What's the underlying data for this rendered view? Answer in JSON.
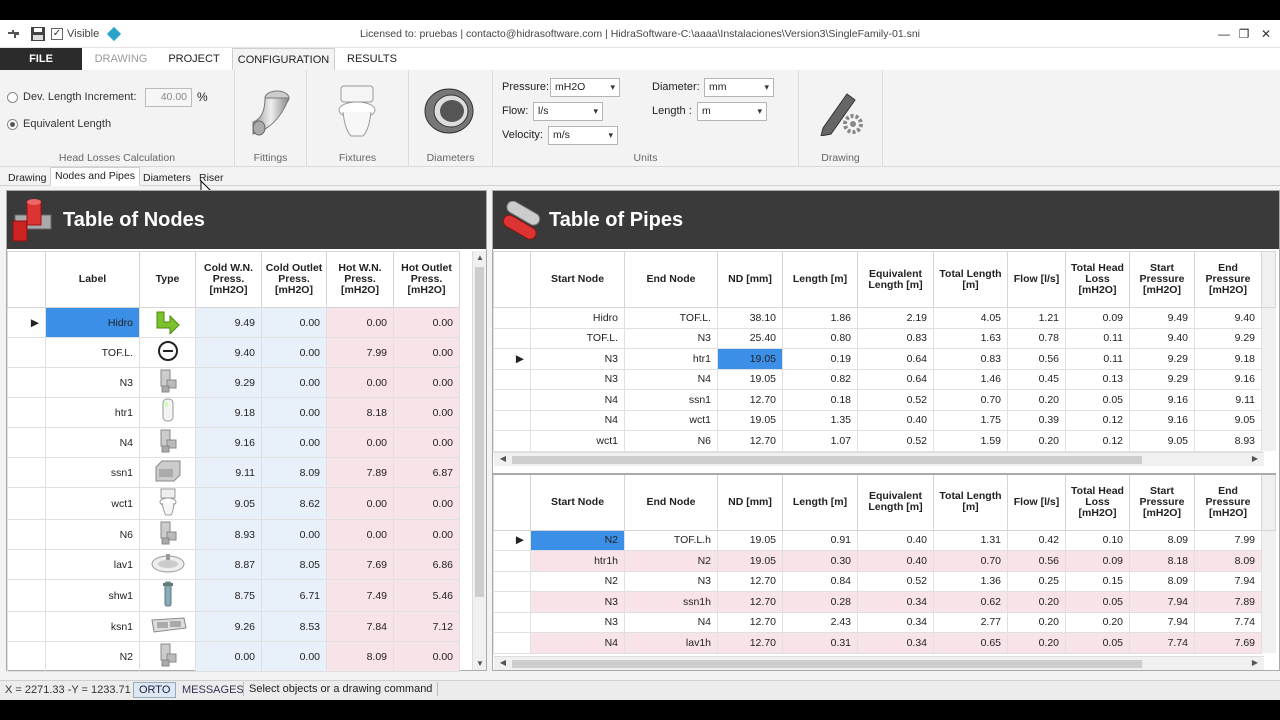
{
  "titlebar": {
    "visible_label": "Visible",
    "title": "Licensed to: pruebas | contacto@hidrasoftware.com | HidraSoftware-C:\\aaaa\\Instalaciones\\Version3\\SingleFamily-01.sni",
    "minimize": "—",
    "restore": "❐",
    "close": "✕"
  },
  "ribbon_tabs": [
    "FILE",
    "DRAWING",
    "PROJECT",
    "CONFIGURATION",
    "RESULTS"
  ],
  "head_losses": {
    "dev_length_label": "Dev. Length Increment:",
    "dev_length_value": "40.00",
    "percent": "%",
    "equivalent_label": "Equivalent Length",
    "group_label": "Head Losses Calculation"
  },
  "groups": {
    "fittings": "Fittings",
    "fixtures": "Fixtures",
    "diameters": "Diameters",
    "units": "Units",
    "drawing": "Drawing"
  },
  "units": {
    "pressure_label": "Pressure:",
    "pressure_value": "mH2O",
    "flow_label": "Flow:",
    "flow_value": "l/s",
    "velocity_label": "Velocity:",
    "velocity_value": "m/s",
    "diameter_label": "Diameter:",
    "diameter_value": "mm",
    "length_label": "Length :",
    "length_value": "m"
  },
  "subtabs": [
    "Drawing",
    "Nodes and Pipes",
    "Diameters",
    "Riser"
  ],
  "nodes": {
    "title": "Table of Nodes",
    "headers": [
      "Label",
      "Type",
      "Cold W.N. Press. [mH2O]",
      "Cold Outlet Press. [mH2O]",
      "Hot W.N. Press. [mH2O]",
      "Hot Outlet Press. [mH2O]"
    ],
    "rows": [
      {
        "label": "Hidro",
        "type": "source-icon",
        "c1": "9.49",
        "c2": "0.00",
        "h1": "0.00",
        "h2": "0.00"
      },
      {
        "label": "TOF.L.",
        "type": "tee-icon",
        "c1": "9.40",
        "c2": "0.00",
        "h1": "7.99",
        "h2": "0.00"
      },
      {
        "label": "N3",
        "type": "elbow-icon",
        "c1": "9.29",
        "c2": "0.00",
        "h1": "0.00",
        "h2": "0.00"
      },
      {
        "label": "htr1",
        "type": "heater-icon",
        "c1": "9.18",
        "c2": "0.00",
        "h1": "8.18",
        "h2": "0.00"
      },
      {
        "label": "N4",
        "type": "elbow-icon",
        "c1": "9.16",
        "c2": "0.00",
        "h1": "0.00",
        "h2": "0.00"
      },
      {
        "label": "ssn1",
        "type": "sink-icon",
        "c1": "9.11",
        "c2": "8.09",
        "h1": "7.89",
        "h2": "6.87"
      },
      {
        "label": "wct1",
        "type": "toilet-icon",
        "c1": "9.05",
        "c2": "8.62",
        "h1": "0.00",
        "h2": "0.00"
      },
      {
        "label": "N6",
        "type": "elbow-icon",
        "c1": "8.93",
        "c2": "0.00",
        "h1": "0.00",
        "h2": "0.00"
      },
      {
        "label": "lav1",
        "type": "lavatory-icon",
        "c1": "8.87",
        "c2": "8.05",
        "h1": "7.69",
        "h2": "6.86"
      },
      {
        "label": "shw1",
        "type": "shower-icon",
        "c1": "8.75",
        "c2": "6.71",
        "h1": "7.49",
        "h2": "5.46"
      },
      {
        "label": "ksn1",
        "type": "kitchen-sink-icon",
        "c1": "9.26",
        "c2": "8.53",
        "h1": "7.84",
        "h2": "7.12"
      },
      {
        "label": "N2",
        "type": "elbow-icon",
        "c1": "0.00",
        "c2": "0.00",
        "h1": "8.09",
        "h2": "0.00"
      }
    ]
  },
  "pipes": {
    "title": "Table of Pipes",
    "headers": [
      "Start Node",
      "End Node",
      "ND [mm]",
      "Length [m]",
      "Equivalent Length [m]",
      "Total Length [m]",
      "Flow [l/s]",
      "Total Head Loss [mH2O]",
      "Start Pressure [mH2O]",
      "End Pressure [mH2O]"
    ],
    "cold_rows": [
      [
        "Hidro",
        "TOF.L.",
        "38.10",
        "1.86",
        "2.19",
        "4.05",
        "1.21",
        "0.09",
        "9.49",
        "9.40"
      ],
      [
        "TOF.L.",
        "N3",
        "25.40",
        "0.80",
        "0.83",
        "1.63",
        "0.78",
        "0.11",
        "9.40",
        "9.29"
      ],
      [
        "N3",
        "htr1",
        "19.05",
        "0.19",
        "0.64",
        "0.83",
        "0.56",
        "0.11",
        "9.29",
        "9.18"
      ],
      [
        "N3",
        "N4",
        "19.05",
        "0.82",
        "0.64",
        "1.46",
        "0.45",
        "0.13",
        "9.29",
        "9.16"
      ],
      [
        "N4",
        "ssn1",
        "12.70",
        "0.18",
        "0.52",
        "0.70",
        "0.20",
        "0.05",
        "9.16",
        "9.11"
      ],
      [
        "N4",
        "wct1",
        "19.05",
        "1.35",
        "0.40",
        "1.75",
        "0.39",
        "0.12",
        "9.16",
        "9.05"
      ],
      [
        "wct1",
        "N6",
        "12.70",
        "1.07",
        "0.52",
        "1.59",
        "0.20",
        "0.12",
        "9.05",
        "8.93"
      ]
    ],
    "hot_rows": [
      [
        "N2",
        "TOF.L.h",
        "19.05",
        "0.91",
        "0.40",
        "1.31",
        "0.42",
        "0.10",
        "8.09",
        "7.99"
      ],
      [
        "htr1h",
        "N2",
        "19.05",
        "0.30",
        "0.40",
        "0.70",
        "0.56",
        "0.09",
        "8.18",
        "8.09"
      ],
      [
        "N2",
        "N3",
        "12.70",
        "0.84",
        "0.52",
        "1.36",
        "0.25",
        "0.15",
        "8.09",
        "7.94"
      ],
      [
        "N3",
        "ssn1h",
        "12.70",
        "0.28",
        "0.34",
        "0.62",
        "0.20",
        "0.05",
        "7.94",
        "7.89"
      ],
      [
        "N3",
        "N4",
        "12.70",
        "2.43",
        "0.34",
        "2.77",
        "0.20",
        "0.20",
        "7.94",
        "7.74"
      ],
      [
        "N4",
        "lav1h",
        "12.70",
        "0.31",
        "0.34",
        "0.65",
        "0.20",
        "0.05",
        "7.74",
        "7.69"
      ]
    ]
  },
  "status": {
    "coords": "X = 2271.33 -Y = 1233.71",
    "orto": "ORTO",
    "messages": "MESSAGES",
    "prompt": "Select objects or a drawing command"
  }
}
